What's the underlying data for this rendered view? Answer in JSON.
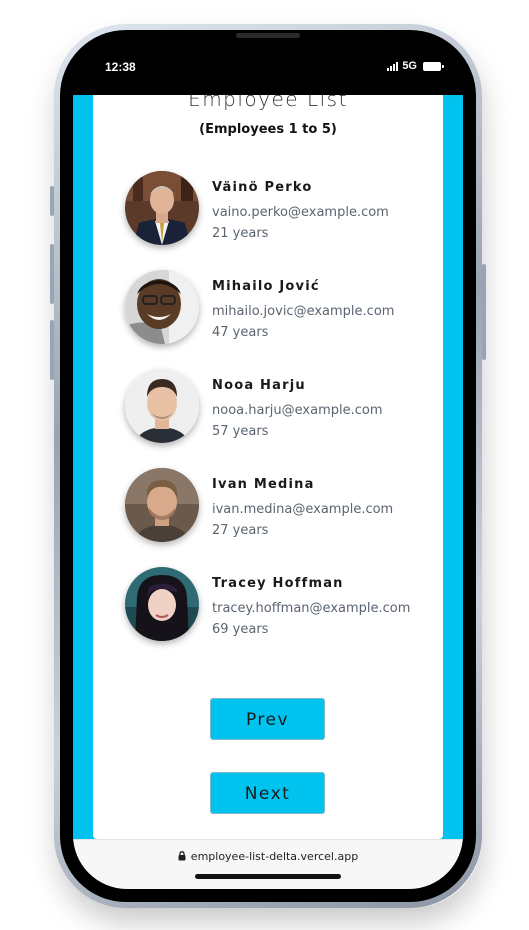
{
  "status_bar": {
    "time": "12:38",
    "network": "5G",
    "signal_icon": "signal-bars-icon",
    "battery_icon": "battery-icon"
  },
  "page": {
    "title": "Employee List",
    "subtitle": "(Employees 1 to 5)"
  },
  "employees": [
    {
      "name": "Väinö Perko",
      "email": "vaino.perko@example.com",
      "age": "21 years"
    },
    {
      "name": "Mihailo Jović",
      "email": "mihailo.jovic@example.com",
      "age": "47 years"
    },
    {
      "name": "Nooa Harju",
      "email": "nooa.harju@example.com",
      "age": "57 years"
    },
    {
      "name": "Ivan Medina",
      "email": "ivan.medina@example.com",
      "age": "27 years"
    },
    {
      "name": "Tracey Hoffman",
      "email": "tracey.hoffman@example.com",
      "age": "69 years"
    }
  ],
  "pagination": {
    "prev_label": "Prev",
    "next_label": "Next"
  },
  "browser": {
    "url": "employee-list-delta.vercel.app",
    "lock_icon": "lock-icon"
  },
  "colors": {
    "accent": "#00c4ef",
    "card": "#ffffff",
    "text_secondary": "#5a6470"
  }
}
